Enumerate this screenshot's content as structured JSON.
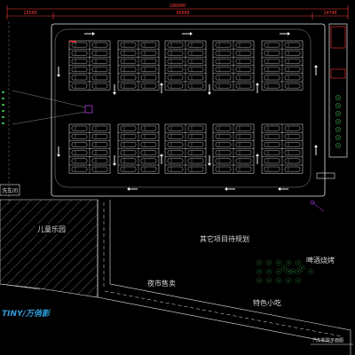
{
  "dimensions": {
    "total": "186000",
    "left": "25500",
    "mid": "95600",
    "right": "14740"
  },
  "labels": {
    "wash_room": "洗车间",
    "playground": "儿童乐园",
    "reserved": "其它项目待规划",
    "night_market": "夜市售卖",
    "beer_bbq": "啤酒烧烤",
    "snacks": "特色小吃",
    "drawing_title": "汽车影院平面图",
    "logo_text": "TINY/万俏影"
  },
  "colors": {
    "background": "#000000",
    "boundary": "#e6e6e6",
    "stall": "#e8e8e8",
    "car": "#c8c8c8",
    "lane_arrow": "#f2f2f2",
    "hatch": "#7a7a7a",
    "tree": "#3aa84a",
    "highlight": "#ff2d2d",
    "accent": "#c040ff",
    "dimension": "#ff3b3b"
  },
  "parking": {
    "block_count": 5,
    "top_group_rows": 6,
    "bottom_group_rows": 6,
    "stalls_per_row_each_block": 2
  }
}
